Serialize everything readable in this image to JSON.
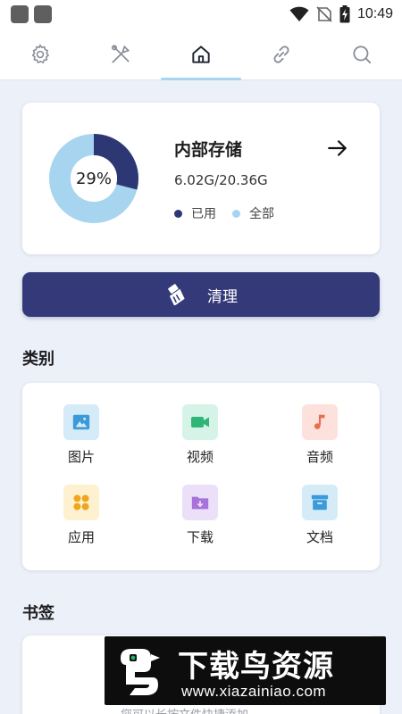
{
  "status_bar": {
    "time": "10:49"
  },
  "tabs": [
    {
      "icon": "gear-icon",
      "active": false
    },
    {
      "icon": "tools-icon",
      "active": false
    },
    {
      "icon": "home-icon",
      "active": true
    },
    {
      "icon": "link-icon",
      "active": false
    },
    {
      "icon": "search-icon",
      "active": false
    }
  ],
  "storage": {
    "percent_label": "29%",
    "used_fraction": 0.29,
    "title": "内部存储",
    "size_text": "6.02G/20.36G",
    "legend_used": "已用",
    "legend_total": "全部",
    "colors": {
      "used": "#2c3774",
      "total": "#a7d5ef"
    }
  },
  "clean_button": {
    "label": "清理"
  },
  "categories": {
    "title": "类别",
    "items": [
      {
        "label": "图片",
        "icon": "image-icon",
        "bg": "#d5ebf8",
        "fg": "#3b9ad8"
      },
      {
        "label": "视频",
        "icon": "video-icon",
        "bg": "#d6f3e8",
        "fg": "#2fb676"
      },
      {
        "label": "音频",
        "icon": "music-icon",
        "bg": "#fde1dc",
        "fg": "#e86e50"
      },
      {
        "label": "应用",
        "icon": "apps-icon",
        "bg": "#fdf1cf",
        "fg": "#f0a51c"
      },
      {
        "label": "下载",
        "icon": "download-folder-icon",
        "bg": "#ebe0f8",
        "fg": "#a772d9"
      },
      {
        "label": "文档",
        "icon": "document-box-icon",
        "bg": "#d5ebf8",
        "fg": "#3b9ad8"
      }
    ]
  },
  "bookmarks": {
    "title": "书签",
    "hint": "您可以长按文件快捷添加"
  },
  "watermark": {
    "title": "下载鸟资源",
    "url": "www.xiazainiao.com"
  }
}
